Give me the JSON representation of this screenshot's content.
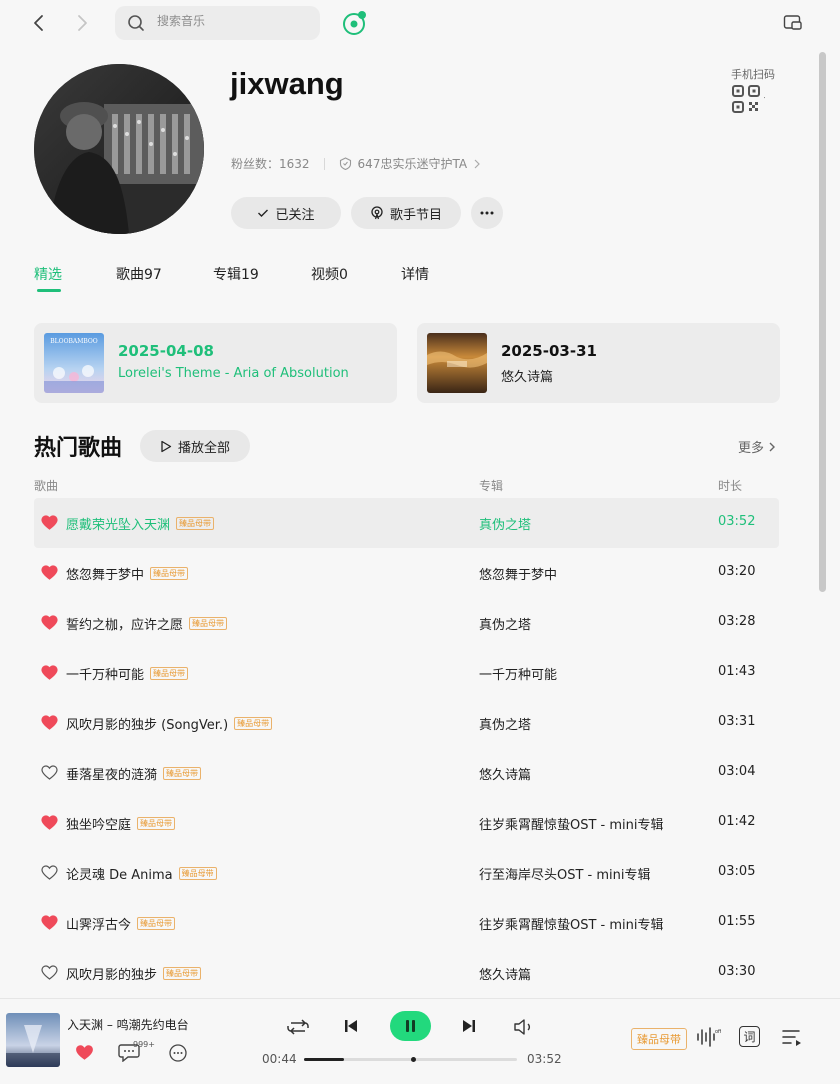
{
  "topbar": {
    "search_placeholder": "搜索音乐"
  },
  "profile": {
    "name": "jixwang",
    "fans_label": "粉丝数：1632",
    "guardian_label": "647忠实乐迷守护TA",
    "follow_label": "已关注",
    "program_label": "歌手节目",
    "qr_label": "手机扫码"
  },
  "tabs": [
    {
      "label": "精选",
      "active": true
    },
    {
      "label": "歌曲97",
      "active": false
    },
    {
      "label": "专辑19",
      "active": false
    },
    {
      "label": "视频0",
      "active": false
    },
    {
      "label": "详情",
      "active": false
    }
  ],
  "releases": [
    {
      "date": "2025-04-08",
      "title": "Lorelei's Theme - Aria of Absolution",
      "highlight": true,
      "cover_text": "BLOOBAMBOO"
    },
    {
      "date": "2025-03-31",
      "title": "悠久诗篇",
      "highlight": false
    }
  ],
  "hot_songs": {
    "title": "热门歌曲",
    "play_all": "播放全部",
    "more": "更多",
    "col_song": "歌曲",
    "col_album": "专辑",
    "col_duration": "时长",
    "badge": "臻品母带",
    "songs": [
      {
        "name": "愿戴荣光坠入天渊",
        "album": "真伪之塔",
        "duration": "03:52",
        "liked": true,
        "playing": true
      },
      {
        "name": "悠忽舞于梦中",
        "album": "悠忽舞于梦中",
        "duration": "03:20",
        "liked": true,
        "playing": false
      },
      {
        "name": "誓约之枷，应许之愿",
        "album": "真伪之塔",
        "duration": "03:28",
        "liked": true,
        "playing": false
      },
      {
        "name": "一千万种可能",
        "album": "一千万种可能",
        "duration": "01:43",
        "liked": true,
        "playing": false
      },
      {
        "name": "风吹月影的独步 (SongVer.)",
        "album": "真伪之塔",
        "duration": "03:31",
        "liked": true,
        "playing": false
      },
      {
        "name": "垂落星夜的涟漪",
        "album": "悠久诗篇",
        "duration": "03:04",
        "liked": false,
        "playing": false
      },
      {
        "name": "独坐吟空庭",
        "album": "往岁乘霄醒惊蛰OST - mini专辑",
        "duration": "01:42",
        "liked": true,
        "playing": false
      },
      {
        "name": "论灵魂 De Anima",
        "album": "行至海岸尽头OST - mini专辑",
        "duration": "03:05",
        "liked": false,
        "playing": false
      },
      {
        "name": "山霁浮古今",
        "album": "往岁乘霄醒惊蛰OST - mini专辑",
        "duration": "01:55",
        "liked": true,
        "playing": false
      },
      {
        "name": "风吹月影的独步",
        "album": "悠久诗篇",
        "duration": "03:30",
        "liked": false,
        "playing": false
      }
    ]
  },
  "player": {
    "now_playing": "坠入天渊 – 鸣潮先约电台",
    "comment_count": "999+",
    "current_time": "00:44",
    "total_time": "03:52",
    "progress": 0.19,
    "quality": "臻品母带",
    "lyrics_label": "词"
  },
  "colors": {
    "accent": "#1fbf7a",
    "heart": "#ef4a5a",
    "badge": "#e89b36"
  }
}
